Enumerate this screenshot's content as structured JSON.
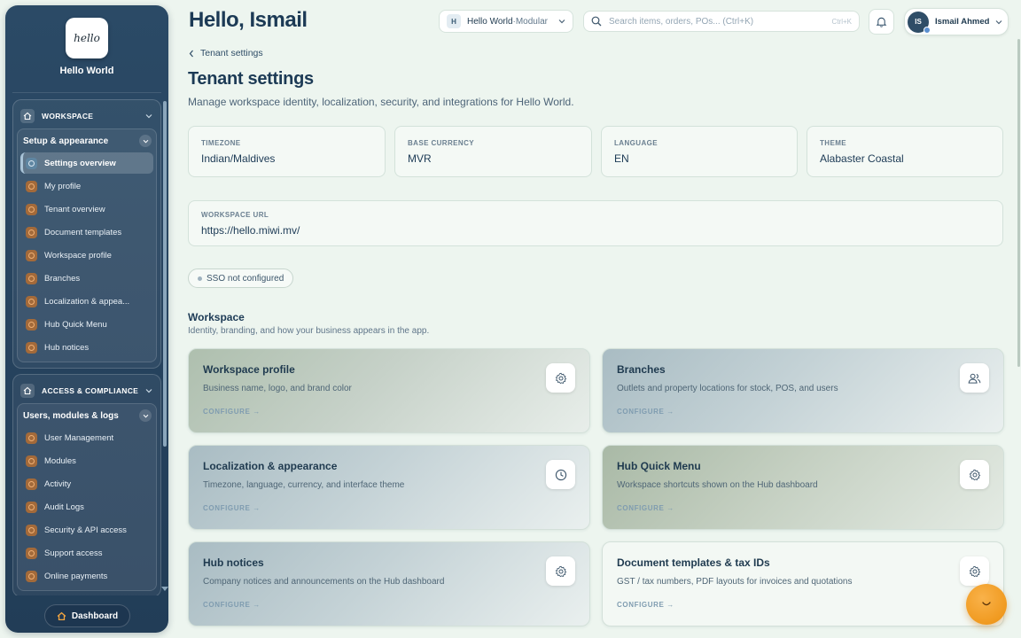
{
  "brand": {
    "logo_text": "hello",
    "name": "Hello World"
  },
  "sidebar": {
    "sections": [
      {
        "title": "WORKSPACE",
        "group": {
          "title": "Setup & appearance",
          "items": [
            {
              "label": "Settings overview",
              "active": true
            },
            {
              "label": "My profile"
            },
            {
              "label": "Tenant overview"
            },
            {
              "label": "Document templates"
            },
            {
              "label": "Workspace profile"
            },
            {
              "label": "Branches"
            },
            {
              "label": "Localization & appea..."
            },
            {
              "label": "Hub Quick Menu"
            },
            {
              "label": "Hub notices"
            }
          ]
        }
      },
      {
        "title": "ACCESS & COMPLIANCE",
        "group": {
          "title": "Users, modules & logs",
          "items": [
            {
              "label": "User Management"
            },
            {
              "label": "Modules"
            },
            {
              "label": "Activity"
            },
            {
              "label": "Audit Logs"
            },
            {
              "label": "Security & API access"
            },
            {
              "label": "Support access"
            },
            {
              "label": "Online payments"
            }
          ]
        }
      }
    ],
    "dashboard_label": "Dashboard"
  },
  "header": {
    "greeting": "Hello, Ismail",
    "tenant": {
      "badge": "H",
      "name": "Hello World",
      "separator": "·",
      "mode": "Modular"
    },
    "search": {
      "placeholder": "Search items, orders, POs... (Ctrl+K)",
      "shortcut": "Ctrl+K"
    },
    "user": {
      "initials": "IS",
      "name": "Ismail Ahmed"
    }
  },
  "main": {
    "breadcrumb": "Tenant settings",
    "title": "Tenant settings",
    "description": "Manage workspace identity, localization, security, and integrations for Hello World.",
    "stats": [
      {
        "label": "TIMEZONE",
        "value": "Indian/Maldives"
      },
      {
        "label": "BASE CURRENCY",
        "value": "MVR"
      },
      {
        "label": "LANGUAGE",
        "value": "EN"
      },
      {
        "label": "THEME",
        "value": "Alabaster Coastal"
      }
    ],
    "workspace_url": {
      "label": "WORKSPACE URL",
      "value": "https://hello.miwi.mv/"
    },
    "sso_status": "SSO not configured",
    "workspace_section": {
      "title": "Workspace",
      "subtitle": "Identity, branding, and how your business appears in the app."
    },
    "cards": [
      {
        "title": "Workspace profile",
        "description": "Business name, logo, and brand color",
        "cta": "CONFIGURE →",
        "icon": "gear-icon"
      },
      {
        "title": "Branches",
        "description": "Outlets and property locations for stock, POS, and users",
        "cta": "CONFIGURE →",
        "icon": "users-icon"
      },
      {
        "title": "Localization & appearance",
        "description": "Timezone, language, currency, and interface theme",
        "cta": "CONFIGURE →",
        "icon": "clock-icon"
      },
      {
        "title": "Hub Quick Menu",
        "description": "Workspace shortcuts shown on the Hub dashboard",
        "cta": "CONFIGURE →",
        "icon": "gear-icon"
      },
      {
        "title": "Hub notices",
        "description": "Company notices and announcements on the Hub dashboard",
        "cta": "CONFIGURE →",
        "icon": "gear-icon"
      },
      {
        "title": "Document templates & tax IDs",
        "description": "GST / tax numbers, PDF layouts for invoices and quotations",
        "cta": "CONFIGURE →",
        "icon": "gear-icon"
      }
    ]
  },
  "colors": {
    "sidebar": "#26435e",
    "page_bg": "#edf5ef",
    "accent": "#f09a20",
    "heading": "#1c3a55"
  }
}
